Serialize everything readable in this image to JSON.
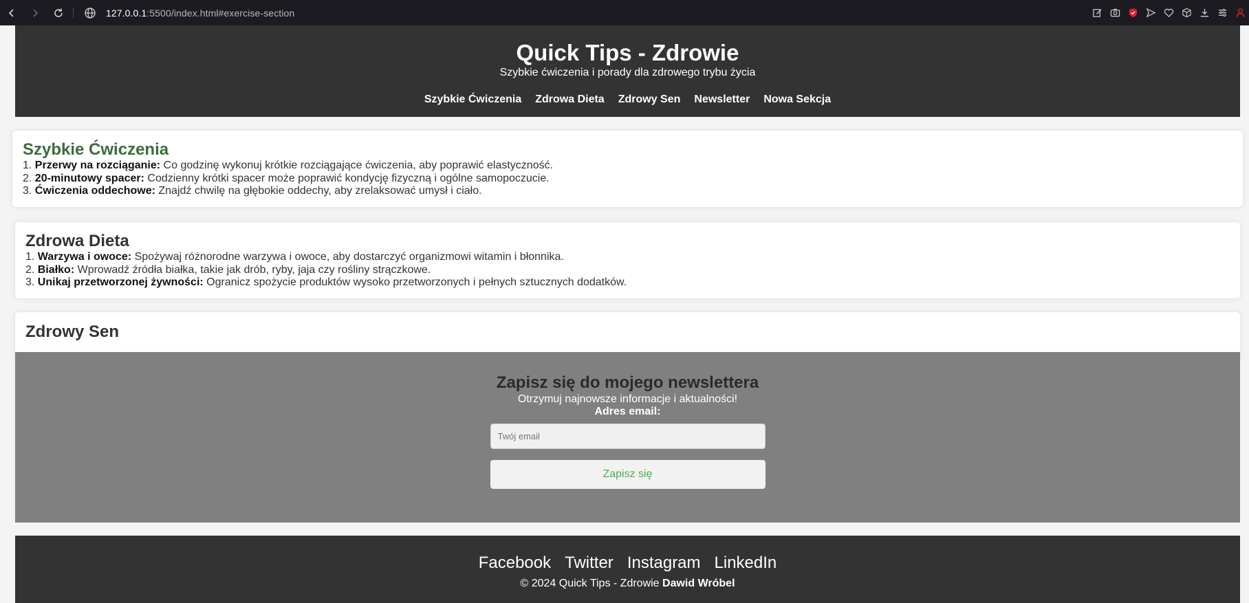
{
  "browser": {
    "url_host": "127.0.0.1",
    "url_rest": ":5500/index.html#exercise-section",
    "icons": [
      "back-icon",
      "forward-icon",
      "reload-icon",
      "site-info-icon",
      "edit-icon",
      "screenshot-icon",
      "shield-icon",
      "send-icon",
      "heart-icon",
      "box-icon",
      "download-icon",
      "menu-icon",
      "profile-icon"
    ]
  },
  "header": {
    "title": "Quick Tips - Zdrowie",
    "subtitle": "Szybkie ćwiczenia i porady dla zdrowego trybu życia",
    "nav": [
      {
        "label": "Szybkie Ćwiczenia"
      },
      {
        "label": "Zdrowa Dieta"
      },
      {
        "label": "Zdrowy Sen"
      },
      {
        "label": "Newsletter"
      },
      {
        "label": "Nowa Sekcja"
      }
    ]
  },
  "exercise": {
    "title": "Szybkie Ćwiczenia",
    "items": [
      {
        "num": "1.",
        "bold": "Przerwy na rozciąganie:",
        "text": " Co godzinę wykonuj krótkie rozciągające ćwiczenia, aby poprawić elastyczność."
      },
      {
        "num": "2.",
        "bold": "20-minutowy spacer:",
        "text": " Codzienny krótki spacer może poprawić kondycję fizyczną i ogólne samopoczucie."
      },
      {
        "num": "3.",
        "bold": "Ćwiczenia oddechowe:",
        "text": " Znajdź chwilę na głębokie oddechy, aby zrelaksować umysł i ciało."
      }
    ]
  },
  "diet": {
    "title": "Zdrowa Dieta",
    "items": [
      {
        "num": "1.",
        "bold": "Warzywa i owoce:",
        "text": " Spożywaj różnorodne warzywa i owoce, aby dostarczyć organizmowi witamin i błonnika."
      },
      {
        "num": "2.",
        "bold": "Białko:",
        "text": " Wprowadź źródła białka, takie jak drób, ryby, jaja czy rośliny strączkowe."
      },
      {
        "num": "3.",
        "bold": "Unikaj przetworzonej żywności:",
        "text": " Ogranicz spożycie produktów wysoko przetworzonych i pełnych sztucznych dodatków."
      }
    ]
  },
  "sleep": {
    "title": "Zdrowy Sen"
  },
  "newsletter": {
    "title": "Zapisz się do mojego newslettera",
    "description": "Otrzymuj najnowsze informacje i aktualności!",
    "email_label": "Adres email:",
    "email_placeholder": "Twój email",
    "email_value": "",
    "submit_label": "Zapisz się"
  },
  "footer": {
    "links": [
      {
        "label": "Facebook"
      },
      {
        "label": "Twitter"
      },
      {
        "label": "Instagram"
      },
      {
        "label": "LinkedIn"
      }
    ],
    "copyright": "© 2024 Quick Tips - Zdrowie ",
    "author": "Dawid Wróbel"
  },
  "colors": {
    "header_bg": "#333333",
    "exercise_title": "#3d6b3d",
    "newsletter_bg": "#808080",
    "submit_text": "#4caf50",
    "shield": "#e0202e"
  }
}
